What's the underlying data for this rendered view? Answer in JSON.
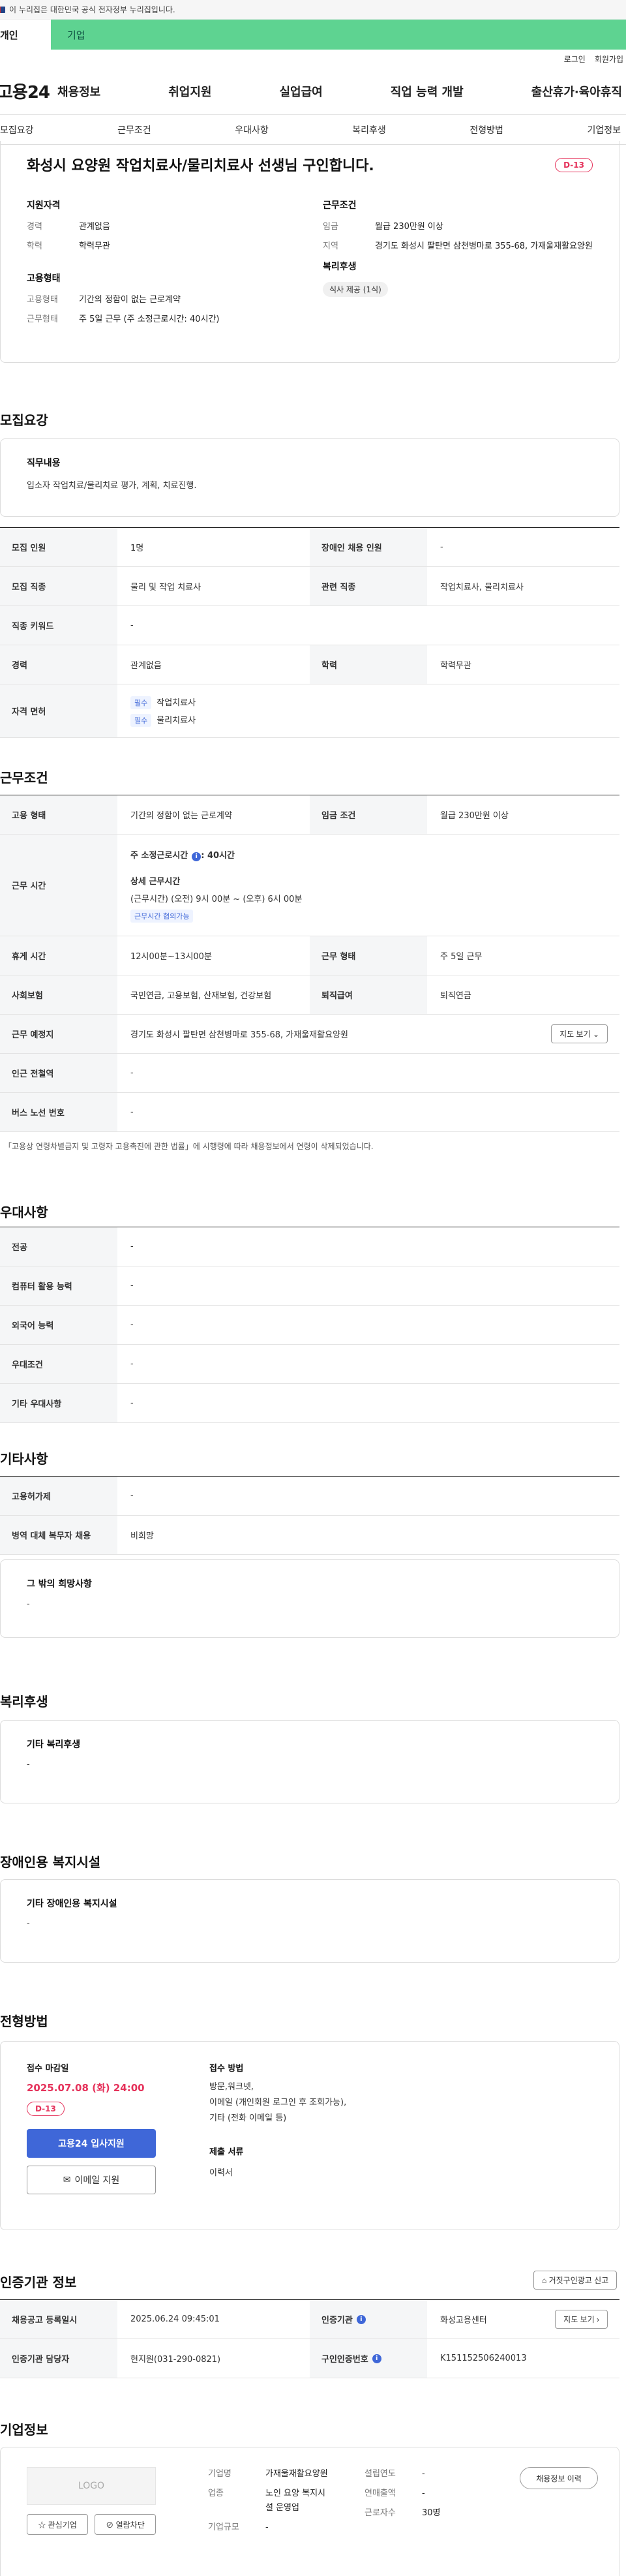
{
  "gov_notice": "이 누리집은 대한민국 공식 전자정부 누리집입니다.",
  "tabs": {
    "personal": "개인",
    "company": "기업"
  },
  "util": {
    "login": "로그인",
    "signup": "회원가입"
  },
  "logo": "고용24",
  "gnb": [
    "채용정보",
    "취업지원",
    "실업급여",
    "직업 능력 개발",
    "출산휴가·육아휴직"
  ],
  "anchors": [
    "모집요강",
    "근무조건",
    "우대사항",
    "복리후생",
    "전형방법",
    "기업정보"
  ],
  "summary": {
    "title": "화성시 요양원 작업치료사/물리치료사 선생님 구인합니다.",
    "dday": "D-13",
    "qual_title": "지원자격",
    "qual": [
      {
        "k": "경력",
        "v": "관계없음"
      },
      {
        "k": "학력",
        "v": "학력무관"
      }
    ],
    "cond_title": "근무조건",
    "cond": [
      {
        "k": "임금",
        "v": "월급 230만원 이상"
      },
      {
        "k": "지역",
        "v": "경기도 화성시 팔탄면 삼천병마로 355-68, 가재울재활요양원"
      }
    ],
    "emp_title": "고용형태",
    "emp": [
      {
        "k": "고용형태",
        "v": "기간의 정함이 없는 근로계약"
      },
      {
        "k": "근무형태",
        "v": "주 5일 근무 (주 소정근로시간: 40시간)"
      }
    ],
    "welfare_title": "복리후생",
    "welfare_chip": "식사 제공 (1식)"
  },
  "recruit": {
    "title": "모집요강",
    "duty_title": "직무내용",
    "duty": "입소자 작업치료/물리치료 평가, 계획, 치료진행.",
    "rows": {
      "count_k": "모집 인원",
      "count_v": "1명",
      "disabled_k": "장애인 채용 인원",
      "disabled_v": "-",
      "job_k": "모집 직종",
      "job_v": "물리 및 작업 치료사",
      "rel_k": "관련 직종",
      "rel_v": "작업치료사, 물리치료사",
      "kw_k": "직종 키워드",
      "kw_v": "-",
      "career_k": "경력",
      "career_v": "관계없음",
      "edu_k": "학력",
      "edu_v": "학력무관",
      "license_k": "자격 면허",
      "license_badge": "필수",
      "license_1": "작업치료사",
      "license_2": "물리치료사"
    }
  },
  "work": {
    "title": "근무조건",
    "type_k": "고용 형태",
    "type_v": "기간의 정함이 없는 근로계약",
    "wage_k": "임금 조건",
    "wage_v": "월급 230만원 이상",
    "time_k": "근무 시간",
    "week_hours": "주 소정근로시간",
    "week_hours_v": ": 40시간",
    "detail_title": "상세 근무시간",
    "detail_v": "(근무시간) (오전) 9시 00분 ~ (오후) 6시 00분",
    "consult": "근무시간 협의가능",
    "rest_k": "휴게 시간",
    "rest_v": "12시00분~13시00분",
    "form_k": "근무 형태",
    "form_v": "주 5일 근무",
    "ins_k": "사회보험",
    "ins_v": "국민연금, 고용보험, 산재보험, 건강보험",
    "sev_k": "퇴직급여",
    "sev_v": "퇴직연금",
    "place_k": "근무 예정지",
    "place_v": "경기도 화성시 팔탄면 삼천병마로 355-68, 가재울재활요양원",
    "map_btn": "지도 보기",
    "subway_k": "인근 전철역",
    "subway_v": "-",
    "bus_k": "버스 노선 번호",
    "bus_v": "-",
    "note": "「고용상 연령차별금지 및 고령자 고용촉진에 관한 법률」에 시행령에 따라 채용정보에서 연령이 삭제되었습니다."
  },
  "pref": {
    "title": "우대사항",
    "rows": [
      {
        "k": "전공",
        "v": "-"
      },
      {
        "k": "컴퓨터 활용 능력",
        "v": "-"
      },
      {
        "k": "외국어 능력",
        "v": "-"
      },
      {
        "k": "우대조건",
        "v": "-"
      },
      {
        "k": "기타 우대사항",
        "v": "-"
      }
    ]
  },
  "etc": {
    "title": "기타사항",
    "rows": [
      {
        "k": "고용허가제",
        "v": "-"
      },
      {
        "k": "병역 대체 복무자 채용",
        "v": "비희망"
      }
    ],
    "other_title": "그 밖의 희망사항",
    "other_v": "-"
  },
  "welfare": {
    "title": "복리후생",
    "sub": "기타 복리후생",
    "v": "-"
  },
  "facility": {
    "title": "장애인용 복지시설",
    "sub": "기타 장애인용 복지시설",
    "v": "-"
  },
  "selection": {
    "title": "전형방법",
    "deadline_label": "접수 마감일",
    "deadline": "2025.07.08 (화) 24:00",
    "dday": "D-13",
    "apply_btn": "고용24 입사지원",
    "email_btn": "이메일 지원",
    "method_label": "접수 방법",
    "method_lines": [
      "방문,워크넷,",
      "이메일 (개인회원 로그인 후 조회가능),",
      "기타 (전화 이메일 등)"
    ],
    "docs_label": "제출 서류",
    "docs_v": "이력서"
  },
  "agency": {
    "title": "인증기관 정보",
    "report_btn": "거짓구인광고 신고",
    "reg_k": "채용공고 등록일시",
    "reg_v": "2025.06.24 09:45:01",
    "cert_k": "인증기관",
    "cert_v": "화성고용센터",
    "map_btn": "지도 보기",
    "mgr_k": "인증기관 담당자",
    "mgr_v": "현지원(031-290-0821)",
    "no_k": "구인인증번호",
    "no_v": "K151152506240013"
  },
  "company": {
    "title": "기업정보",
    "logo": "LOGO",
    "fav_btn": "관심기업",
    "block_btn": "열람차단",
    "name_k": "기업명",
    "name_v": "가재울재활요양원",
    "ind_k": "업종",
    "ind_v1": "노인 요양 복지시",
    "ind_v2": "설 운영업",
    "size_k": "기업규모",
    "size_v": "-",
    "year_k": "설립연도",
    "year_v": "-",
    "sales_k": "연매출액",
    "sales_v": "-",
    "emp_k": "근로자수",
    "emp_v": "30명",
    "history_btn": "채용정보 이력"
  }
}
